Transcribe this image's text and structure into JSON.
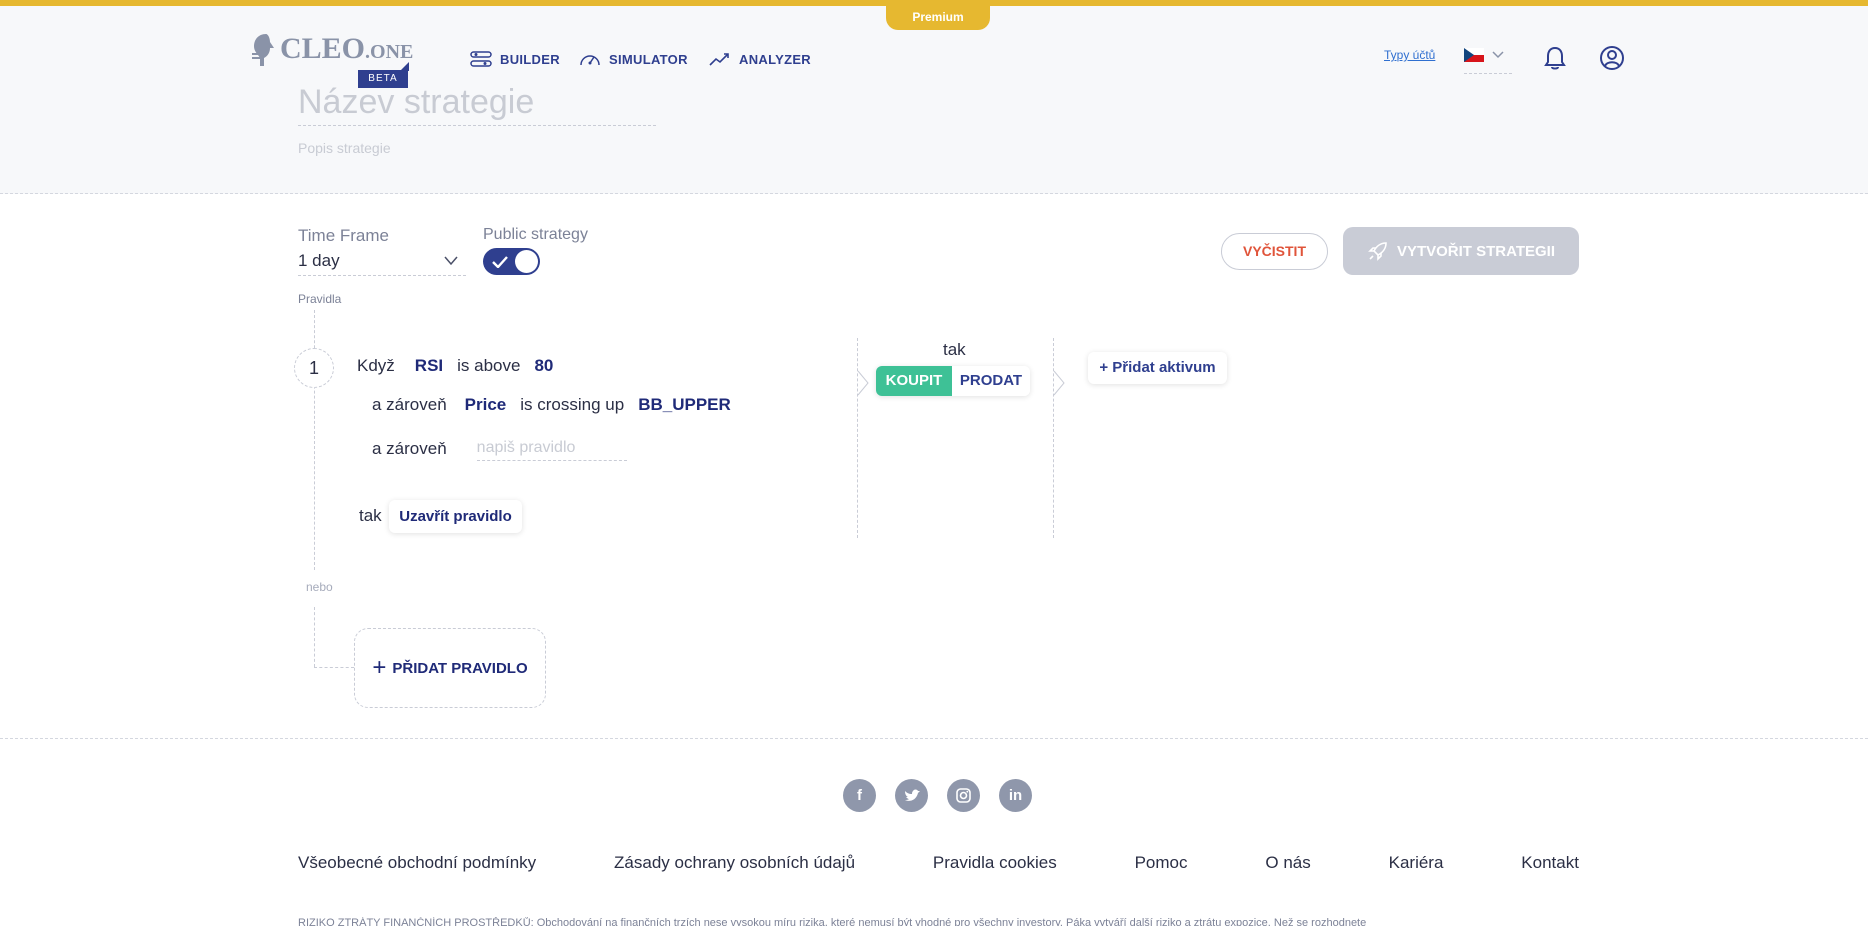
{
  "header": {
    "premium_label": "Premium",
    "logo_text": "CLEO",
    "logo_suffix": ".ONE",
    "beta_label": "BETA",
    "nav": [
      {
        "label": "BUILDER",
        "icon": "sliders-icon"
      },
      {
        "label": "SIMULATOR",
        "icon": "speedometer-icon"
      },
      {
        "label": "ANALYZER",
        "icon": "trend-icon"
      }
    ],
    "account_types_link": "Typy účtů",
    "language_flag": "cz-flag-icon",
    "colors": {
      "accent": "#2f3f8f",
      "premium": "#e6b830"
    }
  },
  "strategy": {
    "name_placeholder": "Název strategie",
    "description_placeholder": "Popis strategie"
  },
  "controls": {
    "timeframe_label": "Time Frame",
    "timeframe_value": "1 day",
    "public_label": "Public strategy",
    "public_enabled": true,
    "clear_button": "VYČISTIT",
    "create_button": "VYTVOŘIT STRATEGII"
  },
  "rules": {
    "section_label": "Pravidla",
    "items": [
      {
        "number": "1",
        "conditions": [
          {
            "prefix": "Když",
            "indicator": "RSI",
            "operator": "is above",
            "value": "80"
          },
          {
            "prefix": "a zároveň",
            "indicator": "Price",
            "operator": "is crossing up",
            "value": "BB_UPPER"
          }
        ],
        "new_condition_prefix": "a zároveň",
        "new_condition_placeholder": "napiš pravidlo",
        "then_label": "tak",
        "close_rule_button": "Uzavřít pravidlo",
        "action_label": "tak",
        "buy_label": "KOUPIT",
        "sell_label": "PRODAT",
        "add_asset_button": "+ Přidat aktivum"
      }
    ],
    "or_label": "nebo",
    "add_rule_button": "PŘIDAT PRAVIDLO"
  },
  "footer": {
    "socials": [
      "facebook-icon",
      "twitter-icon",
      "instagram-icon",
      "linkedin-icon"
    ],
    "links": [
      "Všeobecné obchodní podmínky",
      "Zásady ochrany osobních údajů",
      "Pravidla cookies",
      "Pomoc",
      "O nás",
      "Kariéra",
      "Kontakt"
    ],
    "risk_text": "RIZIKO ZTRÁTY FINANČNÍCH PROSTŘEDKŮ: Obchodování na finančních trzích nese vysokou míru rizika, které nemusí být vhodné pro všechny investory. Páka vytváří další riziko a ztrátu expozice. Než se rozhodnete"
  }
}
